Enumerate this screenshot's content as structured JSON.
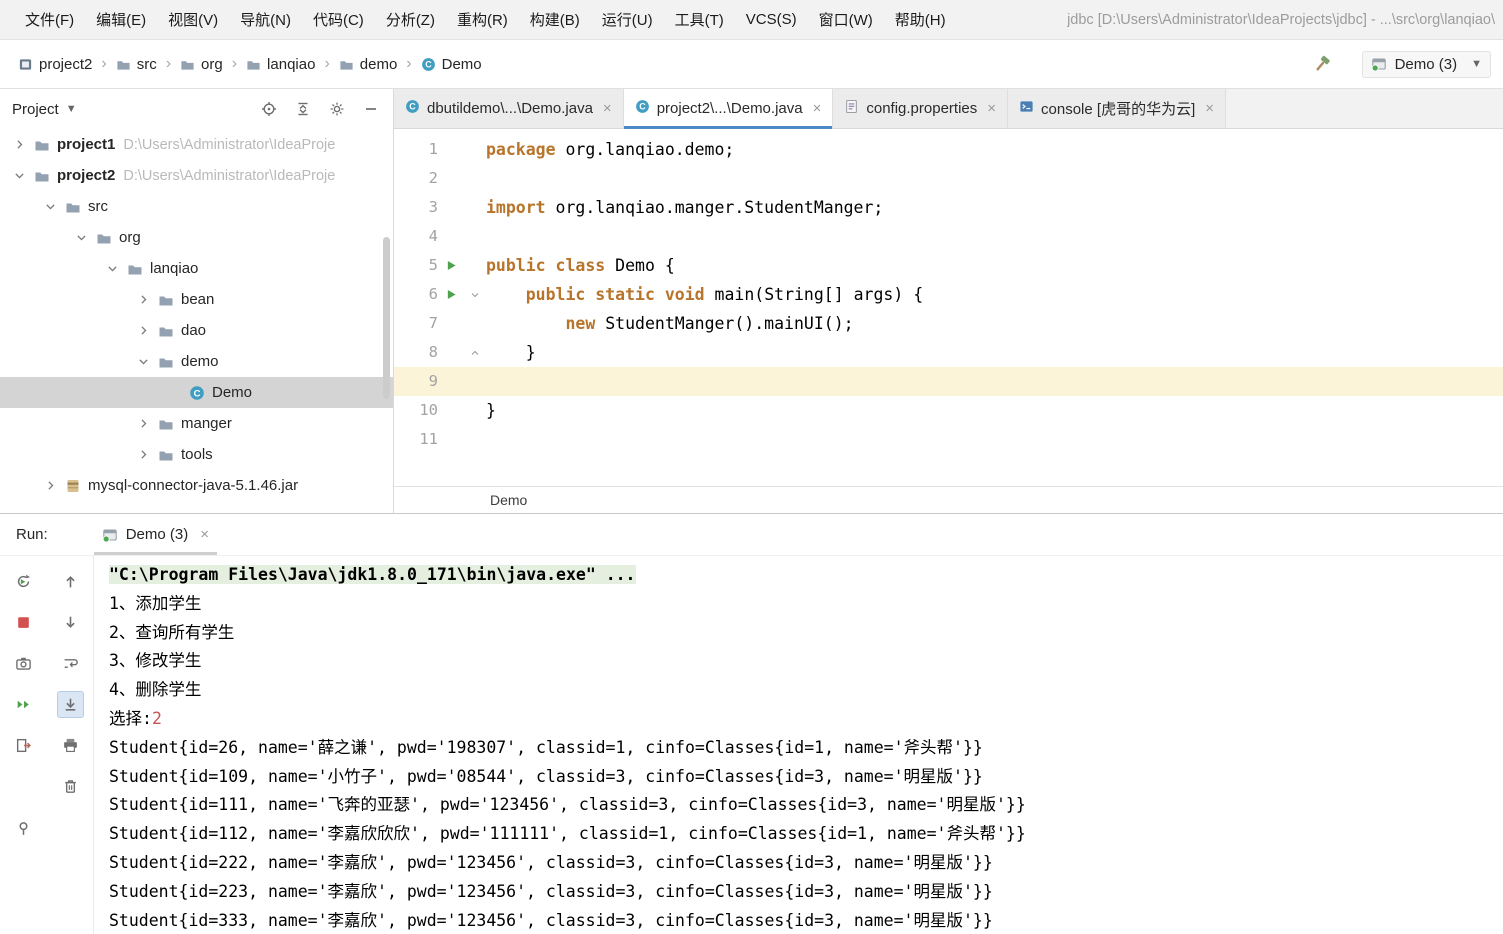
{
  "colors": {
    "keyword": "#b8742a",
    "run_green": "#4ea24e",
    "stop_red": "#d35050",
    "caret_line": "#fbf4d8",
    "selection_gray": "#d4d4d4",
    "active_tab_underline": "#4a88c7",
    "console_input": "#c75450",
    "console_cmd_bg": "#e5efdf"
  },
  "menu_bar": {
    "items": [
      "文件(F)",
      "编辑(E)",
      "视图(V)",
      "导航(N)",
      "代码(C)",
      "分析(Z)",
      "重构(R)",
      "构建(B)",
      "运行(U)",
      "工具(T)",
      "VCS(S)",
      "窗口(W)",
      "帮助(H)"
    ],
    "title": "jdbc [D:\\Users\\Administrator\\IdeaProjects\\jdbc] - ...\\src\\org\\lanqiao\\"
  },
  "nav": {
    "breadcrumbs": [
      {
        "label": "project2",
        "icon": "module-icon"
      },
      {
        "label": "src",
        "icon": "folder-icon"
      },
      {
        "label": "org",
        "icon": "folder-icon"
      },
      {
        "label": "lanqiao",
        "icon": "folder-icon"
      },
      {
        "label": "demo",
        "icon": "folder-icon"
      },
      {
        "label": "Demo",
        "icon": "class-icon"
      }
    ],
    "run_config": "Demo (3)"
  },
  "project_panel": {
    "title": "Project",
    "header_icons": [
      "target-icon",
      "collapse-all-icon",
      "gear-icon",
      "minimize-icon"
    ],
    "tree": [
      {
        "label": "project1",
        "suffix": "D:\\Users\\Administrator\\IdeaProje",
        "depth": 0,
        "chevron": "right",
        "icon": "folder-icon",
        "bold": true
      },
      {
        "label": "project2",
        "suffix": "D:\\Users\\Administrator\\IdeaProje",
        "depth": 0,
        "chevron": "down",
        "icon": "folder-icon",
        "bold": true
      },
      {
        "label": "src",
        "depth": 1,
        "chevron": "down",
        "icon": "folder-icon"
      },
      {
        "label": "org",
        "depth": 2,
        "chevron": "down",
        "icon": "folder-icon"
      },
      {
        "label": "lanqiao",
        "depth": 3,
        "chevron": "down",
        "icon": "folder-icon"
      },
      {
        "label": "bean",
        "depth": 4,
        "chevron": "right",
        "icon": "folder-icon"
      },
      {
        "label": "dao",
        "depth": 4,
        "chevron": "right",
        "icon": "folder-icon"
      },
      {
        "label": "demo",
        "depth": 4,
        "chevron": "down",
        "icon": "folder-icon"
      },
      {
        "label": "Demo",
        "depth": 5,
        "icon": "class-icon",
        "selected": true
      },
      {
        "label": "manger",
        "depth": 4,
        "chevron": "right",
        "icon": "folder-icon"
      },
      {
        "label": "tools",
        "depth": 4,
        "chevron": "right",
        "icon": "folder-icon"
      },
      {
        "label": "mysql-connector-java-5.1.46.jar",
        "depth": 1,
        "chevron": "right",
        "icon": "jar-icon"
      }
    ]
  },
  "editor": {
    "tabs": [
      {
        "label": "dbutildemo\\...\\Demo.java",
        "icon": "class-icon",
        "active": false
      },
      {
        "label": "project2\\...\\Demo.java",
        "icon": "class-icon",
        "active": true
      },
      {
        "label": "config.properties",
        "icon": "properties-file-icon",
        "active": false
      },
      {
        "label": "console [虎哥的华为云]",
        "icon": "console-icon",
        "active": false
      }
    ],
    "breadcrumb": "Demo",
    "code_lines": [
      {
        "n": "1",
        "tokens": [
          [
            "package",
            "kw"
          ],
          [
            " org.lanqiao.demo;",
            "pl"
          ]
        ]
      },
      {
        "n": "2",
        "tokens": []
      },
      {
        "n": "3",
        "tokens": [
          [
            "import",
            "kw"
          ],
          [
            " org.lanqiao.manger.StudentManger;",
            "pl"
          ]
        ]
      },
      {
        "n": "4",
        "tokens": []
      },
      {
        "n": "5",
        "run": true,
        "tokens": [
          [
            "public",
            "kw"
          ],
          [
            " ",
            "pl"
          ],
          [
            "class",
            "kw"
          ],
          [
            " Demo {",
            "pl"
          ]
        ]
      },
      {
        "n": "6",
        "run": true,
        "fold": "down",
        "tokens": [
          [
            "    ",
            "pl"
          ],
          [
            "public",
            "kw"
          ],
          [
            " ",
            "pl"
          ],
          [
            "static",
            "kw"
          ],
          [
            " ",
            "pl"
          ],
          [
            "void",
            "kw"
          ],
          [
            " main(String[] args) {",
            "pl"
          ]
        ]
      },
      {
        "n": "7",
        "tokens": [
          [
            "        ",
            "pl"
          ],
          [
            "new",
            "kw"
          ],
          [
            " StudentManger().mainUI();",
            "pl"
          ]
        ]
      },
      {
        "n": "8",
        "fold": "up",
        "tokens": [
          [
            "    }",
            "pl"
          ]
        ]
      },
      {
        "n": "9",
        "caret": true,
        "tokens": []
      },
      {
        "n": "10",
        "tokens": [
          [
            "}",
            "pl"
          ]
        ]
      },
      {
        "n": "11",
        "tokens": []
      }
    ]
  },
  "run_panel": {
    "label": "Run:",
    "tab": "Demo (3)",
    "toolbar_col1": [
      "rerun-icon",
      "stop-icon",
      "thread-dump-icon",
      "restart-icon",
      "exit-icon",
      "pin-icon"
    ],
    "toolbar_col2": [
      "up-arrow-icon",
      "down-arrow-icon",
      "soft-wrap-icon",
      "scroll-to-end-icon",
      "print-icon",
      "clear-icon"
    ],
    "console": [
      {
        "parts": [
          [
            "\"C:\\Program Files\\Java\\jdk1.8.0_171\\bin\\java.exe\" ...",
            "cmd"
          ]
        ]
      },
      {
        "parts": [
          [
            "1、添加学生",
            "pl"
          ]
        ]
      },
      {
        "parts": [
          [
            "2、查询所有学生",
            "pl"
          ]
        ]
      },
      {
        "parts": [
          [
            "3、修改学生",
            "pl"
          ]
        ]
      },
      {
        "parts": [
          [
            "4、删除学生",
            "pl"
          ]
        ]
      },
      {
        "parts": [
          [
            "选择:",
            "pl"
          ],
          [
            "2",
            "input"
          ]
        ]
      },
      {
        "parts": [
          [
            "Student{id=26, name='薛之谦', pwd='198307', classid=1, cinfo=Classes{id=1, name='斧头帮'}}",
            "pl"
          ]
        ]
      },
      {
        "parts": [
          [
            "Student{id=109, name='小竹子', pwd='08544', classid=3, cinfo=Classes{id=3, name='明星版'}}",
            "pl"
          ]
        ]
      },
      {
        "parts": [
          [
            "Student{id=111, name='飞奔的亚瑟', pwd='123456', classid=3, cinfo=Classes{id=3, name='明星版'}}",
            "pl"
          ]
        ]
      },
      {
        "parts": [
          [
            "Student{id=112, name='李嘉欣欣欣', pwd='111111', classid=1, cinfo=Classes{id=1, name='斧头帮'}}",
            "pl"
          ]
        ]
      },
      {
        "parts": [
          [
            "Student{id=222, name='李嘉欣', pwd='123456', classid=3, cinfo=Classes{id=3, name='明星版'}}",
            "pl"
          ]
        ]
      },
      {
        "parts": [
          [
            "Student{id=223, name='李嘉欣', pwd='123456', classid=3, cinfo=Classes{id=3, name='明星版'}}",
            "pl"
          ]
        ]
      },
      {
        "parts": [
          [
            "Student{id=333, name='李嘉欣', pwd='123456', classid=3, cinfo=Classes{id=3, name='明星版'}}",
            "pl"
          ]
        ]
      }
    ]
  }
}
